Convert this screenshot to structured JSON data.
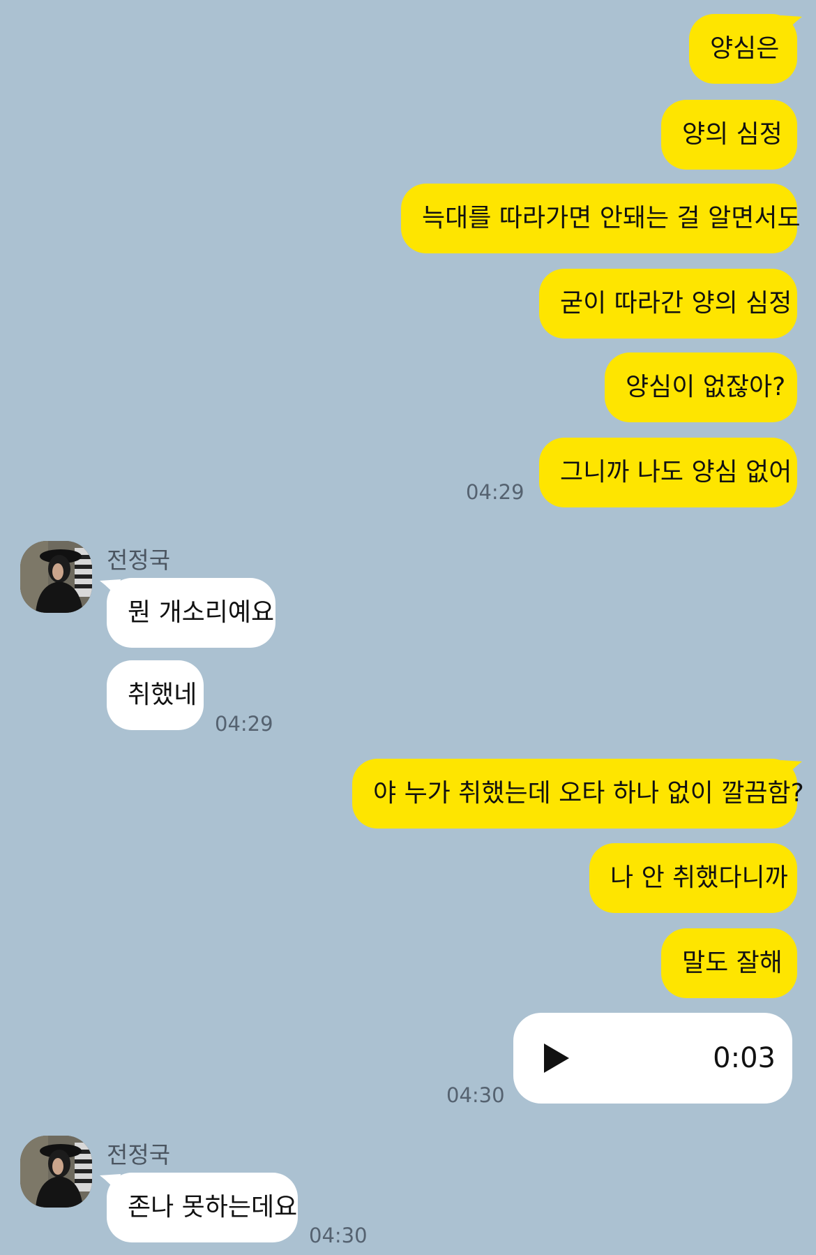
{
  "messages": {
    "m1": "양심은",
    "m2": "양의 심정",
    "m3": "늑대를 따라가면 안돼는 걸 알면서도",
    "m4": "굳이 따라간 양의 심정",
    "m5": "양심이 없잖아?",
    "m6": "그니까 나도 양심 없어",
    "m7": "뭔 개소리예요",
    "m8": "취했네",
    "m9": "야 누가 취했는데 오타 하나 없이 깔끔함?",
    "m10": "나 안 취했다니까",
    "m11": "말도 잘해",
    "m12": "존나 못하는데요"
  },
  "times": {
    "t1": "04:29",
    "t2": "04:29",
    "t3": "04:30",
    "t4": "04:30"
  },
  "sender": {
    "name": "전정국"
  },
  "voice": {
    "duration": "0:03",
    "icon": "play-icon"
  },
  "colors": {
    "background": "#abc1d1",
    "my_bubble": "#fee500",
    "other_bubble": "#ffffff"
  }
}
